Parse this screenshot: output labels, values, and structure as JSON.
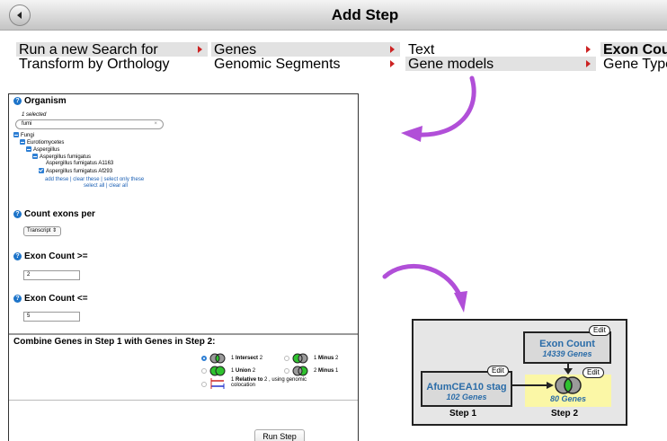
{
  "header": {
    "title": "Add Step",
    "back_icon": "back-arrow-icon"
  },
  "menu": {
    "col1": [
      "Run a new Search for",
      "Transform by Orthology"
    ],
    "col2": [
      "Genes",
      "Genomic Segments"
    ],
    "col3": [
      "Text",
      "Gene models"
    ],
    "col4": [
      "Exon Count",
      "Gene Type"
    ]
  },
  "organism": {
    "title": "Organism",
    "selected_text": "1 selected",
    "search_value": "fumi",
    "clear_icon": "×",
    "tree": [
      {
        "label": "Fungi",
        "level": 0,
        "state": "minus"
      },
      {
        "label": "Eurotiomycetes",
        "level": 1,
        "state": "minus"
      },
      {
        "label": "Aspergillus",
        "level": 2,
        "state": "minus"
      },
      {
        "label": "Aspergillus fumigatus",
        "level": 3,
        "state": "minus"
      },
      {
        "label": "Aspergillus fumigatus A1163",
        "level": 4,
        "state": "none"
      },
      {
        "label": "Aspergillus fumigatus Af293",
        "level": 4,
        "state": "check"
      }
    ],
    "links_line1": "add these | clear these | select only these",
    "links_line2": "select all | clear all"
  },
  "count_exons": {
    "title": "Count exons per",
    "select_value": "Transcript"
  },
  "exon_min": {
    "title": "Exon Count >=",
    "value": "2"
  },
  "exon_max": {
    "title": "Exon Count <=",
    "value": "5"
  },
  "combine": {
    "title": "Combine Genes in Step 1 with Genes in Step 2:",
    "intersect": {
      "pre": "1",
      "op": "Intersect",
      "post": "2"
    },
    "minus": {
      "pre": "1",
      "op": "Minus",
      "post": "2"
    },
    "union": {
      "pre": "1",
      "op": "Union",
      "post": "2"
    },
    "minus2": {
      "pre": "2",
      "op": "Minus",
      "post": "1"
    },
    "relative": {
      "pre": "1",
      "op": "Relative to",
      "post": "2 , using genomic",
      "line2": "colocation"
    }
  },
  "run_button": "Run Step",
  "strategy": {
    "step1_name": "AfumCEA10 stag",
    "step1_count": "102 Genes",
    "step2_name": "Exon Count",
    "step2_count": "14339 Genes",
    "combined_count": "80 Genes",
    "edit_label": "Edit",
    "step1_label": "Step 1",
    "step2_label": "Step 2"
  },
  "colors": {
    "arrow": "#b14fd8",
    "link": "#1a5fb4",
    "venn_green": "#2fc22f",
    "highlight": "#fbf7a6"
  }
}
